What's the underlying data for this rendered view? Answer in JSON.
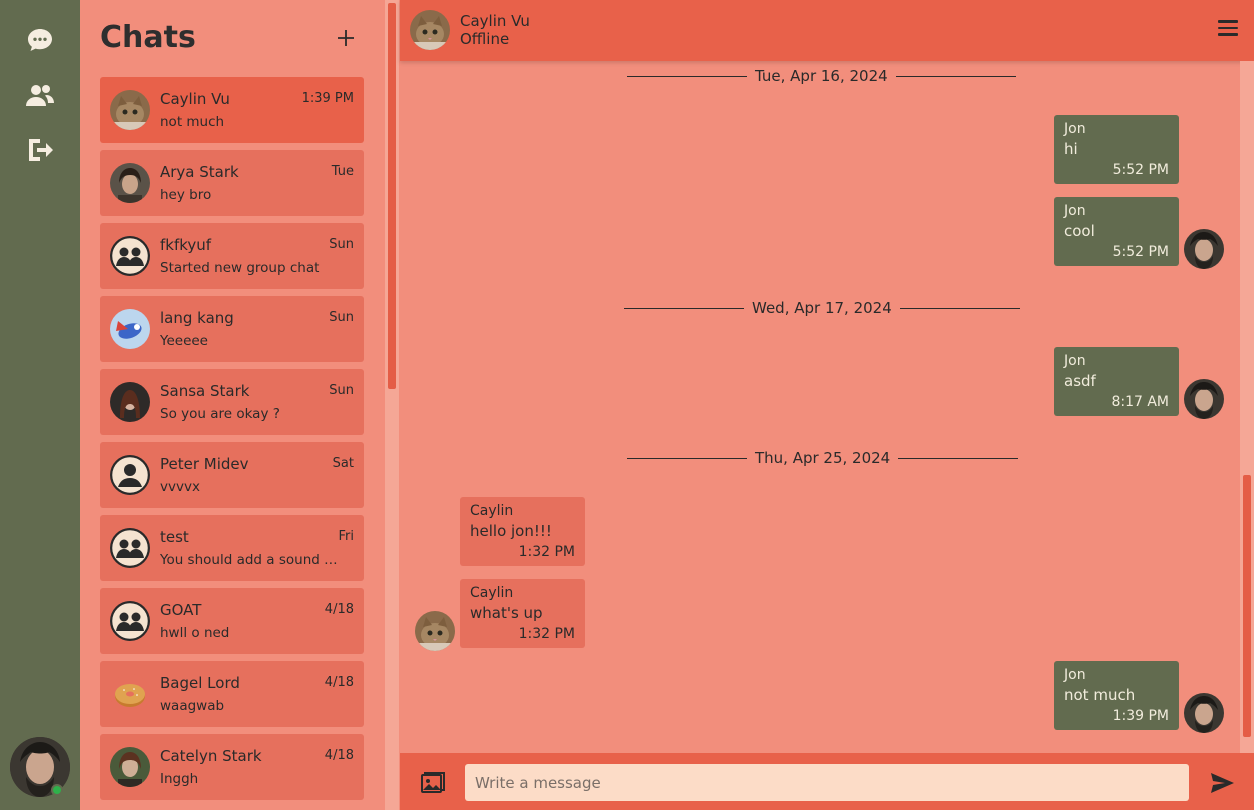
{
  "rail": {
    "icons": [
      "chat-bubble-icon",
      "people-icon",
      "logout-icon"
    ],
    "me_online": true
  },
  "chats_panel": {
    "title": "Chats",
    "items": [
      {
        "name": "Caylin Vu",
        "time": "1:39 PM",
        "preview": "not much",
        "avatar": "cat-photo",
        "active": true
      },
      {
        "name": "Arya Stark",
        "time": "Tue",
        "preview": "hey bro",
        "avatar": "arya-photo"
      },
      {
        "name": "fkfkyuf",
        "time": "Sun",
        "preview": "Started new group chat",
        "avatar": "group-icon"
      },
      {
        "name": "lang kang",
        "time": "Sun",
        "preview": "Yeeeee",
        "avatar": "blue-creature-photo"
      },
      {
        "name": "Sansa Stark",
        "time": "Sun",
        "preview": "So you are okay ?",
        "avatar": "sansa-photo"
      },
      {
        "name": "Peter Midev",
        "time": "Sat",
        "preview": "vvvvx",
        "avatar": "user-icon"
      },
      {
        "name": "test",
        "time": "Fri",
        "preview": "You should add a sound …",
        "avatar": "group-icon"
      },
      {
        "name": "GOAT",
        "time": "4/18",
        "preview": "hwll o ned",
        "avatar": "group-icon"
      },
      {
        "name": "Bagel Lord",
        "time": "4/18",
        "preview": "waagwab",
        "avatar": "bagel-photo"
      },
      {
        "name": "Catelyn Stark",
        "time": "4/18",
        "preview": "Inggh",
        "avatar": "catelyn-photo"
      }
    ]
  },
  "conversation": {
    "name": "Caylin Vu",
    "status": "Offline",
    "dates": [
      "Tue, Apr 16, 2024",
      "Wed, Apr 17, 2024",
      "Thu, Apr 25, 2024"
    ],
    "messages": [
      {
        "sender": "Jon",
        "text": "hi",
        "time": "5:52 PM",
        "mine": true
      },
      {
        "sender": "Jon",
        "text": "cool",
        "time": "5:52 PM",
        "mine": true
      },
      {
        "sender": "Jon",
        "text": "asdf",
        "time": "8:17 AM",
        "mine": true
      },
      {
        "sender": "Caylin",
        "text": "hello jon!!!",
        "time": "1:32 PM",
        "mine": false
      },
      {
        "sender": "Caylin",
        "text": "what's up",
        "time": "1:32 PM",
        "mine": false
      },
      {
        "sender": "Jon",
        "text": "not much",
        "time": "1:39 PM",
        "mine": true
      }
    ]
  },
  "composer": {
    "placeholder": "Write a message"
  },
  "colors": {
    "rail": "#626b4f",
    "panel": "#f28e7c",
    "header": "#e8614a",
    "item": "#e6705d",
    "my_bubble": "#626b4f",
    "input": "#fcdcc7"
  }
}
